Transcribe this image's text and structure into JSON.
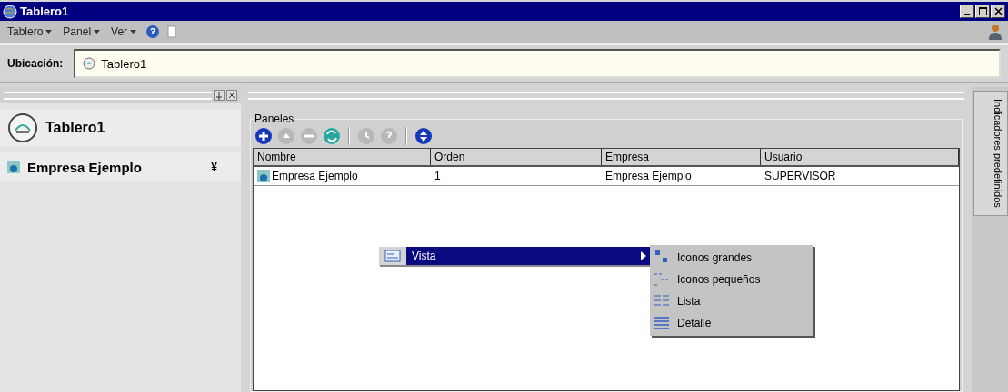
{
  "window": {
    "title": "Tablero1"
  },
  "menu_bar": [
    {
      "label": "Tablero"
    },
    {
      "label": "Panel"
    },
    {
      "label": "Ver"
    }
  ],
  "location": {
    "label": "Ubicación:",
    "value": "Tablero1"
  },
  "sidebar": {
    "items": [
      {
        "kind": "board",
        "label": "Tablero1"
      },
      {
        "kind": "company",
        "label": "Empresa Ejemplo",
        "expander": "¥"
      }
    ]
  },
  "panels": {
    "title": "Paneles",
    "toolbar": [
      {
        "kind": "add",
        "disabled": false
      },
      {
        "kind": "up",
        "disabled": true
      },
      {
        "kind": "remove",
        "disabled": true
      },
      {
        "kind": "refresh",
        "disabled": false
      },
      {
        "kind": "sep"
      },
      {
        "kind": "clock",
        "disabled": true
      },
      {
        "kind": "help",
        "disabled": true
      },
      {
        "kind": "sep"
      },
      {
        "kind": "updown",
        "disabled": false
      }
    ],
    "table": {
      "columns": [
        "Nombre",
        "Orden",
        "Empresa",
        "Usuario"
      ],
      "rows": [
        {
          "cells": [
            "Empresa Ejemplo",
            "1",
            "Empresa Ejemplo",
            "SUPERVISOR"
          ]
        }
      ]
    }
  },
  "context_menu": {
    "items": [
      {
        "label": "Vista",
        "selected": true
      }
    ]
  },
  "submenu": {
    "items": [
      {
        "kind": "large",
        "label": "Iconos grandes"
      },
      {
        "kind": "small",
        "label": "Iconos pequeños"
      },
      {
        "kind": "list",
        "label": "Lista"
      },
      {
        "kind": "detail",
        "label": "Detalle"
      }
    ]
  },
  "side_tab": {
    "label": "Indicadores predefinidos"
  }
}
